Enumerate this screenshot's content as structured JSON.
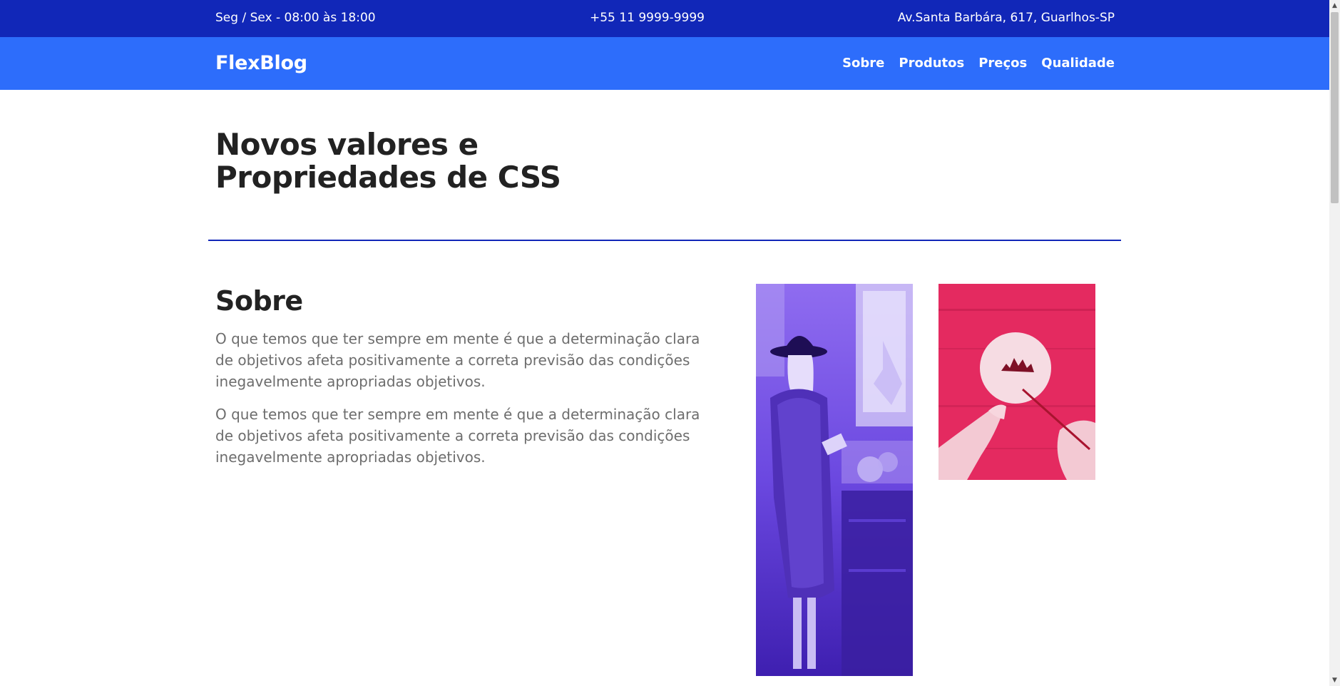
{
  "topbar": {
    "hours": "Seg / Sex - 08:00 às 18:00",
    "phone": "+55 11 9999-9999",
    "address": "Av.Santa Barbára, 617, Guarlhos-SP"
  },
  "header": {
    "logo": "FlexBlog",
    "nav": [
      "Sobre",
      "Produtos",
      "Preços",
      "Qualidade"
    ]
  },
  "hero": {
    "title_line1": "Novos valores e",
    "title_line2": "Propriedades de CSS"
  },
  "sobre": {
    "title": "Sobre",
    "paragraphs": [
      "O que temos que ter sempre em mente é que a determinação clara de objetivos afeta positivamente a correta previsão das condições inegavelmente apropriadas objetivos.",
      "O que temos que ter sempre em mente é que a determinação clara de objetivos afeta positivamente a correta previsão das condições inegavelmente apropriadas objetivos."
    ]
  },
  "colors": {
    "topbar": "#1127b8",
    "navbar": "#2d6dfb",
    "divider": "#1127b8",
    "image_purple": "#5a35d8",
    "image_red": "#e8255f"
  },
  "icons": {
    "scroll_up": "scroll-up-arrow-icon",
    "scroll_down": "scroll-down-arrow-icon"
  }
}
